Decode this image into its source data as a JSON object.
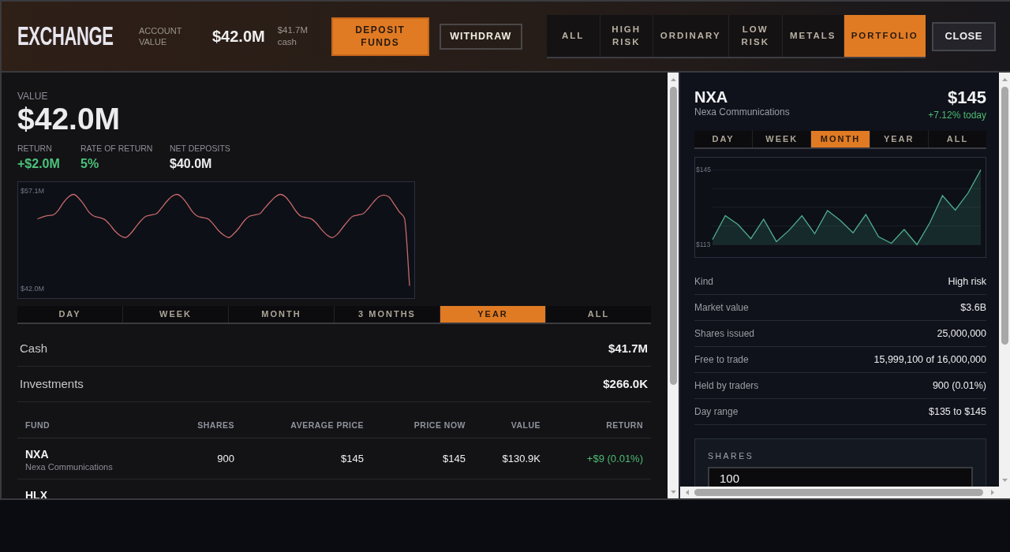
{
  "header": {
    "logo": "EXCHANGE",
    "account_value_label": "ACCOUNT VALUE",
    "account_value": "$42.0M",
    "cash_value": "$41.7M",
    "cash_label": "cash",
    "buttons": [
      {
        "label": "DEPOSIT FUNDS",
        "kind": "primary"
      },
      {
        "label": "WITHDRAW",
        "kind": "outline"
      }
    ],
    "category_tabs": [
      {
        "label": "ALL",
        "selected": false
      },
      {
        "label": "HIGH RISK",
        "selected": false
      },
      {
        "label": "ORDINARY",
        "selected": false
      },
      {
        "label": "LOW RISK",
        "selected": false
      },
      {
        "label": "METALS",
        "selected": false
      },
      {
        "label": "PORTFOLIO",
        "selected": true
      }
    ],
    "close_button": "CLOSE"
  },
  "portfolio": {
    "value_label": "VALUE",
    "value": "$42.0M",
    "stats": [
      {
        "label": "RETURN",
        "value": "+$2.0M",
        "color": "#4cc27a"
      },
      {
        "label": "RATE OF RETURN",
        "value": "5%",
        "color": "#4cc27a"
      },
      {
        "label": "NET DEPOSITS",
        "value": "$40.0M",
        "color": "#ececee"
      }
    ],
    "chart_data": {
      "type": "line",
      "ylim": [
        40.5,
        58.5
      ],
      "series": [
        {
          "color": "#c8696b",
          "values": [
            52.8,
            53.1,
            53.3,
            53.4,
            54.1,
            55.3,
            56.2,
            56.6,
            56.0,
            55.0,
            53.8,
            53.2,
            53.0,
            52.7,
            51.9,
            50.9,
            50.2,
            49.9,
            50.5,
            51.5,
            52.5,
            53.2,
            53.4,
            53.6,
            54.5,
            55.5,
            56.3,
            56.6,
            56.1,
            55.1,
            53.9,
            53.2,
            53.0,
            52.8,
            52.0,
            51.0,
            50.3,
            49.9,
            50.5,
            51.4,
            52.5,
            53.2,
            53.4,
            53.6,
            54.5,
            55.4,
            56.2,
            56.6,
            56.2,
            55.2,
            54.0,
            53.2,
            53.0,
            52.8,
            52.1,
            51.1,
            50.3,
            49.9,
            50.4,
            51.4,
            52.4,
            53.2,
            53.4,
            53.6,
            54.4,
            55.4,
            56.2,
            56.5,
            56.2,
            55.1,
            53.9,
            52.9,
            42.4
          ]
        }
      ],
      "yticks": [
        {
          "value": 42.0,
          "label": "$42.0M"
        },
        {
          "value": 57.1,
          "label": "$57.1M"
        }
      ]
    },
    "range_tabs": [
      {
        "label": "DAY",
        "selected": false
      },
      {
        "label": "WEEK",
        "selected": false
      },
      {
        "label": "MONTH",
        "selected": false
      },
      {
        "label": "3 MONTHS",
        "selected": false
      },
      {
        "label": "YEAR",
        "selected": true
      },
      {
        "label": "ALL",
        "selected": false
      }
    ],
    "balances": [
      {
        "label": "Cash",
        "value": "$41.7M"
      },
      {
        "label": "Investments",
        "value": "$266.0K"
      }
    ],
    "table": {
      "columns": [
        "FUND",
        "SHARES",
        "AVERAGE PRICE",
        "PRICE NOW",
        "VALUE",
        "RETURN"
      ],
      "rows": [
        {
          "fund": "NXA",
          "name": "Nexa Communications",
          "shares": "900",
          "average_price": "$145",
          "price_now": "$145",
          "value": "$130.9K",
          "return": "+$9 (0.01%)"
        },
        {
          "fund": "HLX"
        }
      ]
    }
  },
  "detail": {
    "symbol": "NXA",
    "name": "Nexa Communications",
    "price": "$145",
    "change": "+7.12% today",
    "range_tabs": [
      {
        "label": "DAY",
        "selected": false
      },
      {
        "label": "WEEK",
        "selected": false
      },
      {
        "label": "MONTH",
        "selected": true
      },
      {
        "label": "YEAR",
        "selected": false
      },
      {
        "label": "ALL",
        "selected": false
      }
    ],
    "chart_data": {
      "type": "area",
      "ylim": [
        107.7,
        150.2
      ],
      "series": [
        {
          "color": "#4fae8e",
          "values": [
            115.2,
            125.4,
            121.6,
            115.6,
            123.9,
            114.3,
            119.2,
            125.4,
            117.7,
            127.6,
            123.4,
            118.1,
            125.9,
            116.4,
            113.6,
            119.5,
            113.0,
            122.3,
            134.0,
            127.8,
            135.1,
            145.0
          ]
        }
      ],
      "yticks": [
        {
          "value": 113,
          "label": "$113"
        },
        {
          "value": 145,
          "label": "$145"
        }
      ]
    },
    "facts": [
      {
        "label": "Kind",
        "value": "High risk"
      },
      {
        "label": "Market value",
        "value": "$3.6B"
      },
      {
        "label": "Shares issued",
        "value": "25,000,000"
      },
      {
        "label": "Free to trade",
        "value": "15,999,100 of 16,000,000"
      },
      {
        "label": "Held by traders",
        "value": "900 (0.01%)"
      },
      {
        "label": "Day range",
        "value": "$135 to $145"
      }
    ],
    "order": {
      "label": "SHARES",
      "value": "100"
    }
  }
}
